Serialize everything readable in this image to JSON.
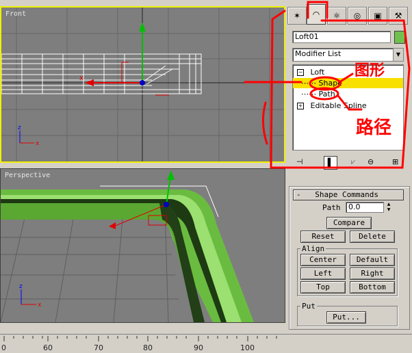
{
  "viewports": {
    "front_label": "Front",
    "perspective_label": "Perspective"
  },
  "panel": {
    "tabs": [
      "create-icon",
      "modify-icon",
      "hierarchy-icon",
      "motion-icon",
      "display-icon",
      "utilities-icon"
    ],
    "object_name": "Loft01",
    "object_color": "#70c050",
    "modifier_list": "Modifier List",
    "stack": {
      "loft": "Loft",
      "shape": "Shape",
      "path": "Path",
      "editable_spline": "Editable Spline"
    },
    "rollout_title": "Shape Commands",
    "path_label": "Path",
    "path_value": "0.0",
    "compare_label": "Compare",
    "reset_label": "Reset",
    "delete_label": "Delete",
    "align_label": "Align",
    "center_label": "Center",
    "default_label": "Default",
    "left_label": "Left",
    "right_label": "Right",
    "top_label": "Top",
    "bottom_label": "Bottom",
    "put_group_label": "Put",
    "put_button_label": "Put..."
  },
  "annotations": {
    "shape_note": "图形",
    "path_note": "路径",
    "annotation_color": "#ff0000"
  },
  "ruler": {
    "ticks": [
      "0",
      "60",
      "70",
      "80",
      "90",
      "100"
    ]
  }
}
